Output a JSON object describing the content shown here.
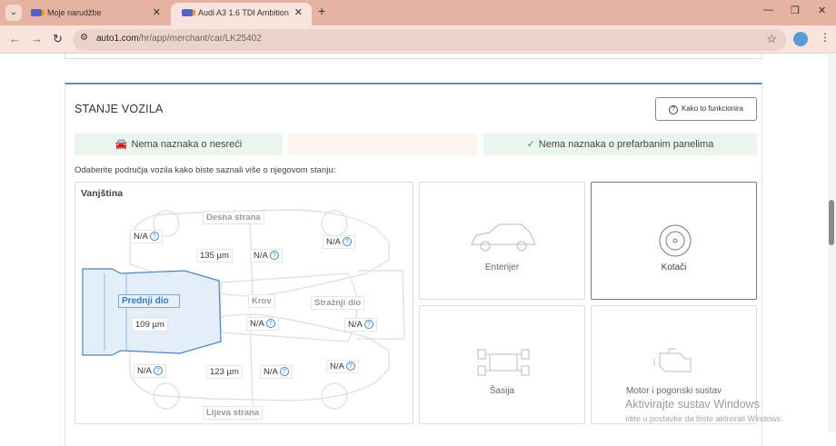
{
  "browser": {
    "tabs": [
      {
        "label": "Moje narudžbe"
      },
      {
        "label": "Audi A3 1.6 TDI Ambition",
        "active": true
      }
    ],
    "url_host": "auto1.com",
    "url_path": "/hr/app/merchant/car/LK25402"
  },
  "section": {
    "title": "STANJE VOZILA",
    "how_button": "Kako to funkcionira",
    "status": [
      {
        "label": "Nema naznaka o nesreći",
        "icon": "car-icon"
      },
      {
        "label": ""
      },
      {
        "label": "Nema naznaka o prefarbanim panelima",
        "icon": "check-icon"
      }
    ],
    "instruction": "Odaberite područja vozila kako biste saznali više o njegovom stanju:"
  },
  "exterior": {
    "title": "Vanjština",
    "areas": {
      "right": "Desna strana",
      "left": "Lijeva strana",
      "front": "Prednji dio",
      "roof": "Krov",
      "rear": "Stražnji dio"
    },
    "readings": {
      "r_front_fender": "N/A",
      "r_front_door": "135 µm",
      "r_rear_door": "N/A",
      "r_rear_fender": "N/A",
      "front": "109 µm",
      "roof": "N/A",
      "rear": "N/A",
      "l_front_fender": "N/A",
      "l_front_door": "123 µm",
      "l_rear_door": "N/A",
      "l_rear_fender": "N/A"
    }
  },
  "tiles": [
    {
      "label": "Enterijer"
    },
    {
      "label": "Kotači",
      "selected": true
    },
    {
      "label": "Šasija"
    },
    {
      "label": "Motor i pogonski sustav"
    }
  ],
  "watermark": {
    "line1": "Aktivirajte sustav Windows",
    "line2": "Idite u postavke da biste aktivirali Windows."
  },
  "colors": {
    "accent": "#3b78b5",
    "ok_bg": "#eaf5ee",
    "tabbar": "#e6b2a2"
  }
}
